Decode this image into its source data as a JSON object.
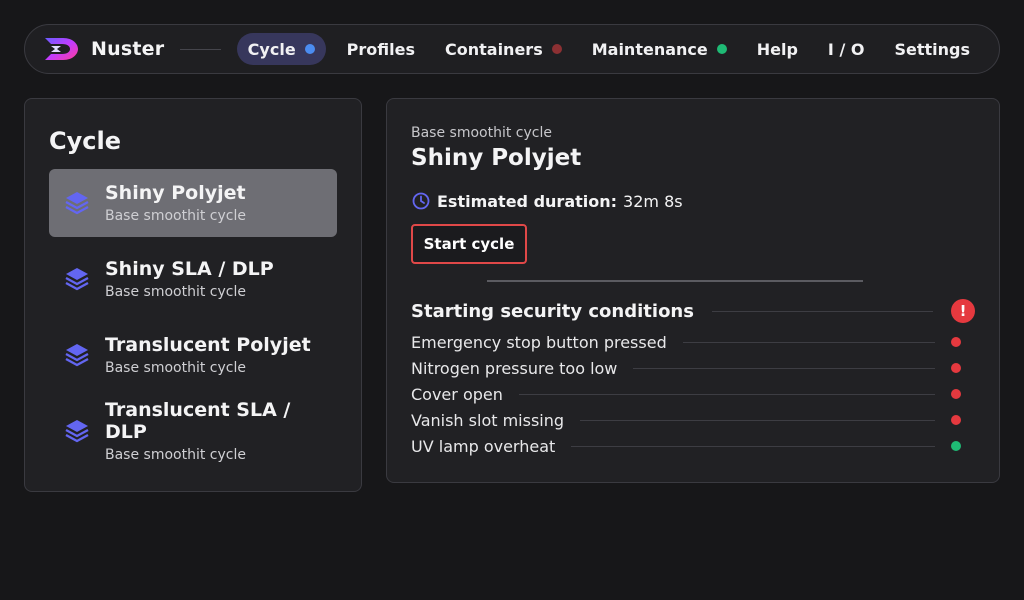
{
  "brand": {
    "name": "Nuster"
  },
  "nav": {
    "items": [
      {
        "label": "Cycle",
        "active": true,
        "indicator": "#4b8cf0"
      },
      {
        "label": "Profiles"
      },
      {
        "label": "Containers",
        "indicator": "#8c3033"
      },
      {
        "label": "Maintenance",
        "indicator": "#1fba75"
      },
      {
        "label": "Help"
      },
      {
        "label": "I / O"
      },
      {
        "label": "Settings"
      }
    ]
  },
  "cycle": {
    "title": "Cycle",
    "profiles": [
      {
        "name": "Shiny Polyjet",
        "subtitle": "Base smoothit cycle",
        "selected": true
      },
      {
        "name": "Shiny SLA / DLP",
        "subtitle": "Base smoothit cycle"
      },
      {
        "name": "Translucent Polyjet",
        "subtitle": "Base smoothit cycle"
      },
      {
        "name": "Translucent SLA / DLP",
        "subtitle": "Base smoothit cycle"
      }
    ]
  },
  "detail": {
    "type": "Base smoothit cycle",
    "name": "Shiny Polyjet",
    "duration_label": "Estimated duration:",
    "duration_value": "32m 8s",
    "start_label": "Start cycle",
    "security": {
      "title": "Starting security conditions",
      "alert": "!",
      "conditions": [
        {
          "label": "Emergency stop button pressed",
          "status_color": "#e5393f"
        },
        {
          "label": "Nitrogen pressure too low",
          "status_color": "#e5393f"
        },
        {
          "label": "Cover open",
          "status_color": "#e5393f"
        },
        {
          "label": "Vanish slot missing",
          "status_color": "#e5393f"
        },
        {
          "label": "UV lamp overheat",
          "status_color": "#1fba75"
        }
      ]
    }
  },
  "colors": {
    "accent": "#6366f1",
    "danger": "#e5393f",
    "success": "#1fba75"
  }
}
